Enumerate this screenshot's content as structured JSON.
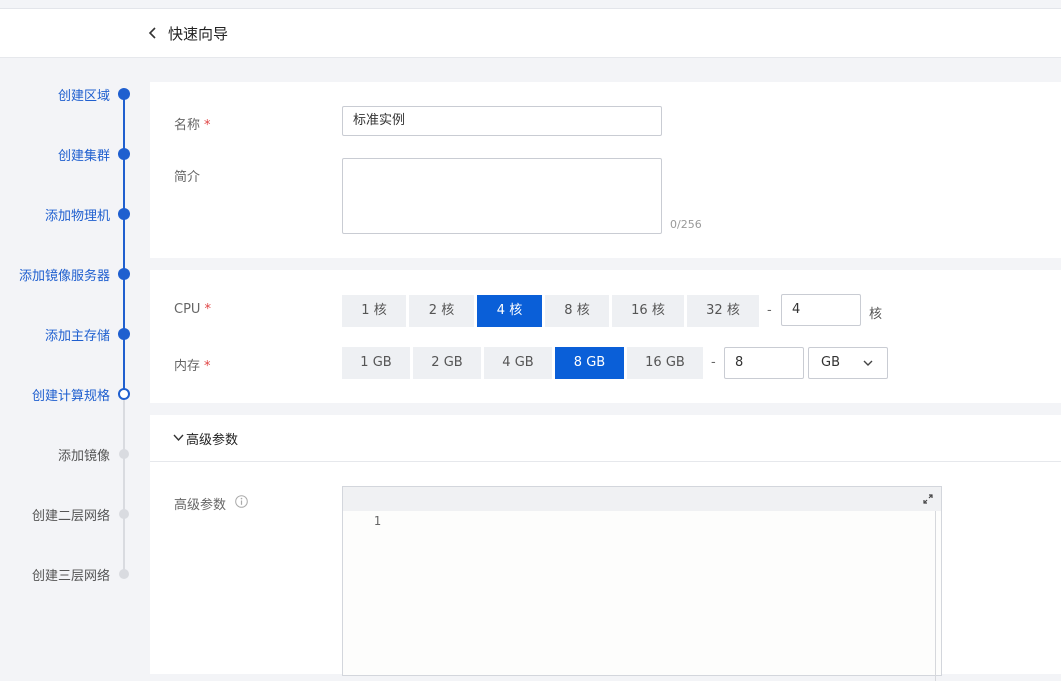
{
  "header": {
    "title": "快速向导",
    "back_icon": "chevron-left-icon"
  },
  "steps": [
    {
      "label": "创建区域",
      "status": "done"
    },
    {
      "label": "创建集群",
      "status": "done"
    },
    {
      "label": "添加物理机",
      "status": "done"
    },
    {
      "label": "添加镜像服务器",
      "status": "done"
    },
    {
      "label": "添加主存储",
      "status": "done"
    },
    {
      "label": "创建计算规格",
      "status": "current"
    },
    {
      "label": "添加镜像",
      "status": "todo"
    },
    {
      "label": "创建二层网络",
      "status": "todo"
    },
    {
      "label": "创建三层网络",
      "status": "todo"
    }
  ],
  "basic": {
    "name_label": "名称",
    "required_mark": "*",
    "name_value": "标准实例",
    "desc_label": "简介",
    "desc_value": "",
    "desc_counter": "0/256"
  },
  "cpu": {
    "label": "CPU",
    "options": [
      "1 核",
      "2 核",
      "4 核",
      "8 核",
      "16 核",
      "32 核"
    ],
    "selected": "4 核",
    "dash": "-",
    "custom_value": "4",
    "unit": "核"
  },
  "memory": {
    "label": "内存",
    "options": [
      "1 GB",
      "2 GB",
      "4 GB",
      "8 GB",
      "16 GB"
    ],
    "selected": "8 GB",
    "dash": "-",
    "custom_value": "8",
    "unit_selected": "GB"
  },
  "advanced": {
    "section_title": "高级参数",
    "field_label": "高级参数",
    "editor_line": "1"
  },
  "colors": {
    "primary": "#0a5fd8",
    "step_active": "#1f5fcf",
    "required": "#e04343"
  }
}
